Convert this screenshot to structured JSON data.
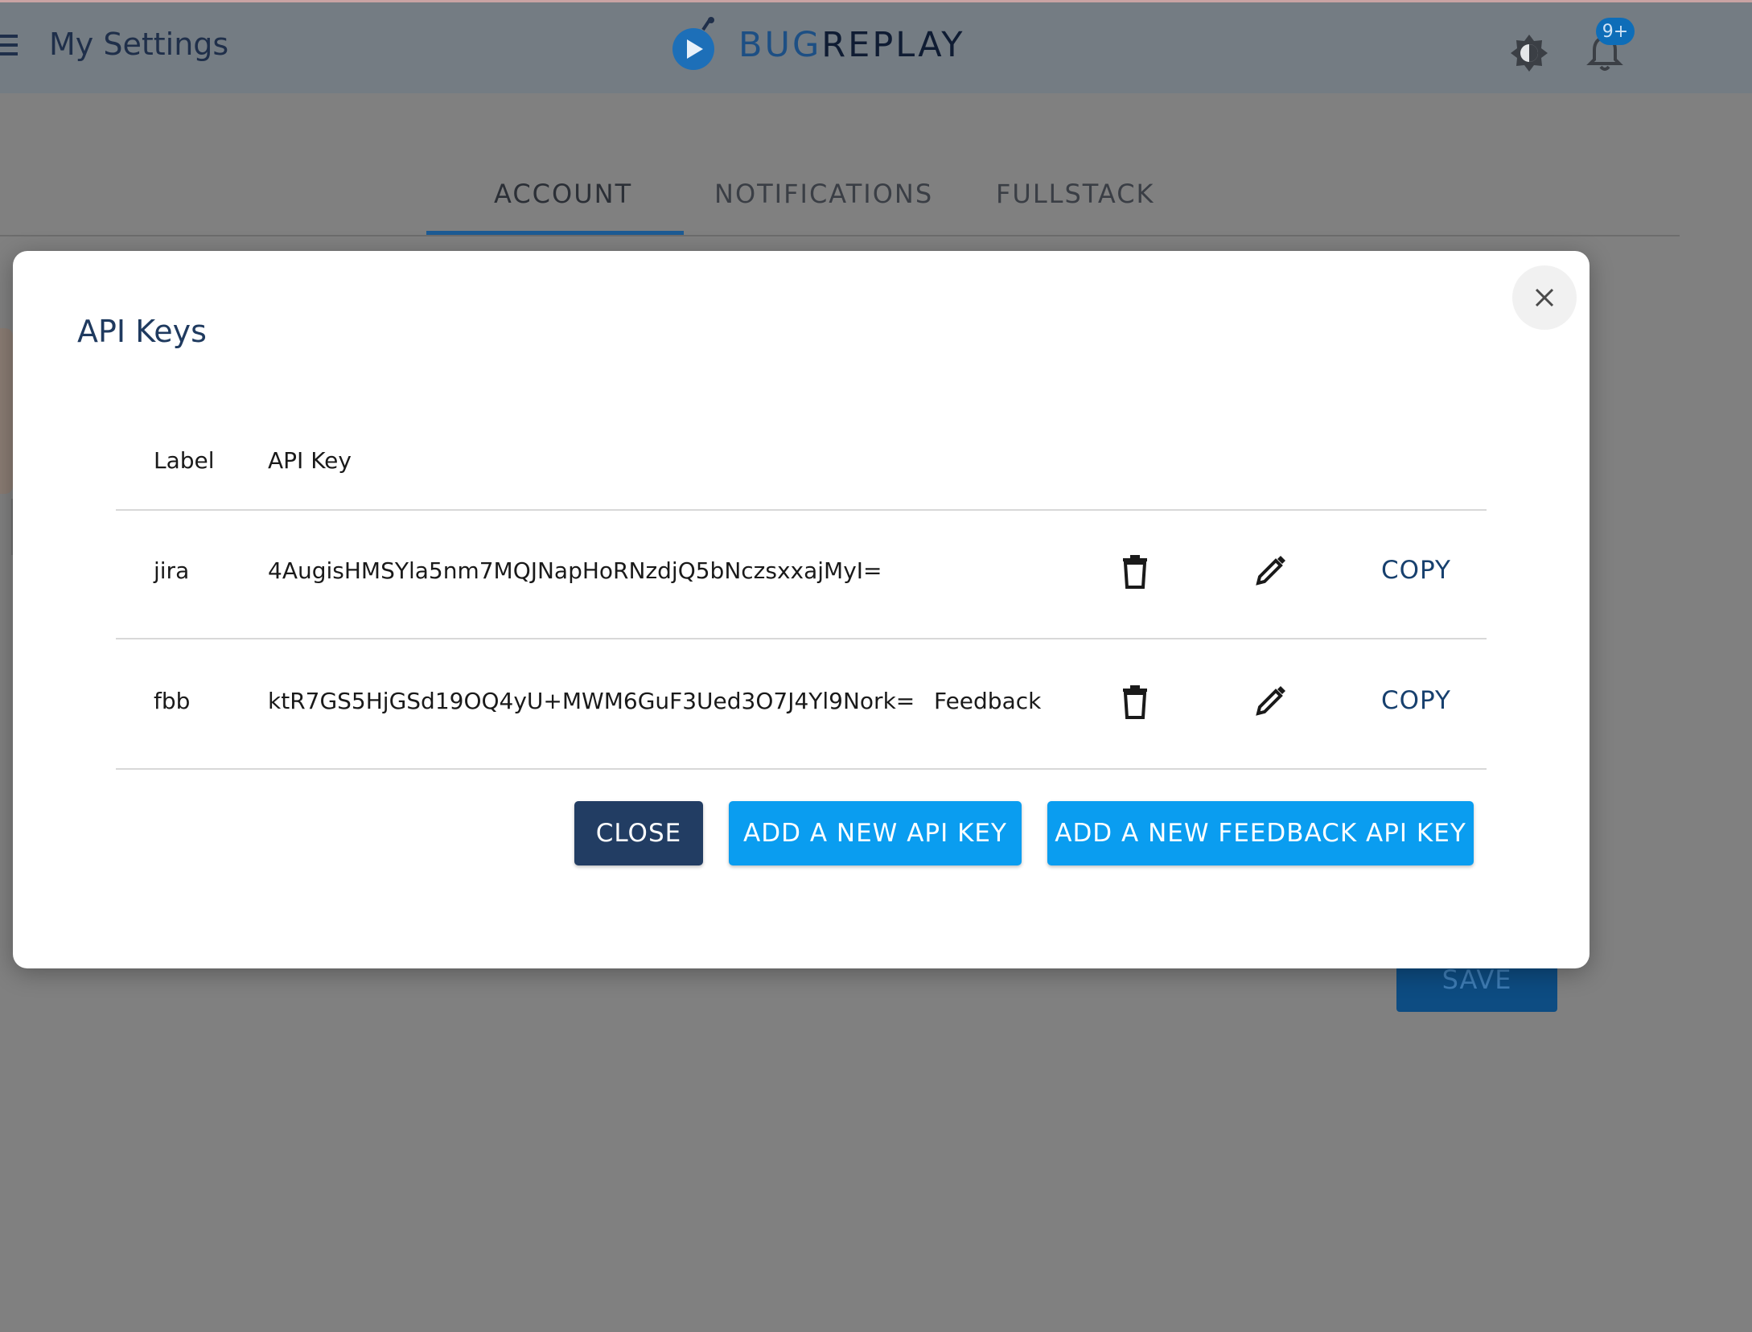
{
  "header": {
    "page_title": "My Settings",
    "logo_bug": "BUG",
    "logo_replay": "REPLAY",
    "notification_badge": "9+"
  },
  "tabs": [
    {
      "label": "ACCOUNT",
      "active": true
    },
    {
      "label": "NOTIFICATIONS",
      "active": false
    },
    {
      "label": "FULLSTACK",
      "active": false
    }
  ],
  "background": {
    "save_label": "SAVE"
  },
  "modal": {
    "title": "API Keys",
    "columns": {
      "label": "Label",
      "api_key": "API Key"
    },
    "rows": [
      {
        "label": "jira",
        "api_key": "4AugisHMSYla5nm7MQJNapHoRNzdjQ5bNczsxxajMyI=",
        "type": "",
        "copy": "COPY"
      },
      {
        "label": "fbb",
        "api_key": "ktR7GS5HjGSd19OQ4yU+MWM6GuF3Ued3O7J4Yl9Nork=",
        "type": "Feedback",
        "copy": "COPY"
      }
    ],
    "buttons": {
      "close": "CLOSE",
      "add_key": "ADD A NEW API KEY",
      "add_feedback_key": "ADD A NEW FEEDBACK API KEY"
    }
  },
  "colors": {
    "primary_dark": "#223d63",
    "primary_blue": "#0a9df0",
    "copy_text": "#17406e"
  }
}
